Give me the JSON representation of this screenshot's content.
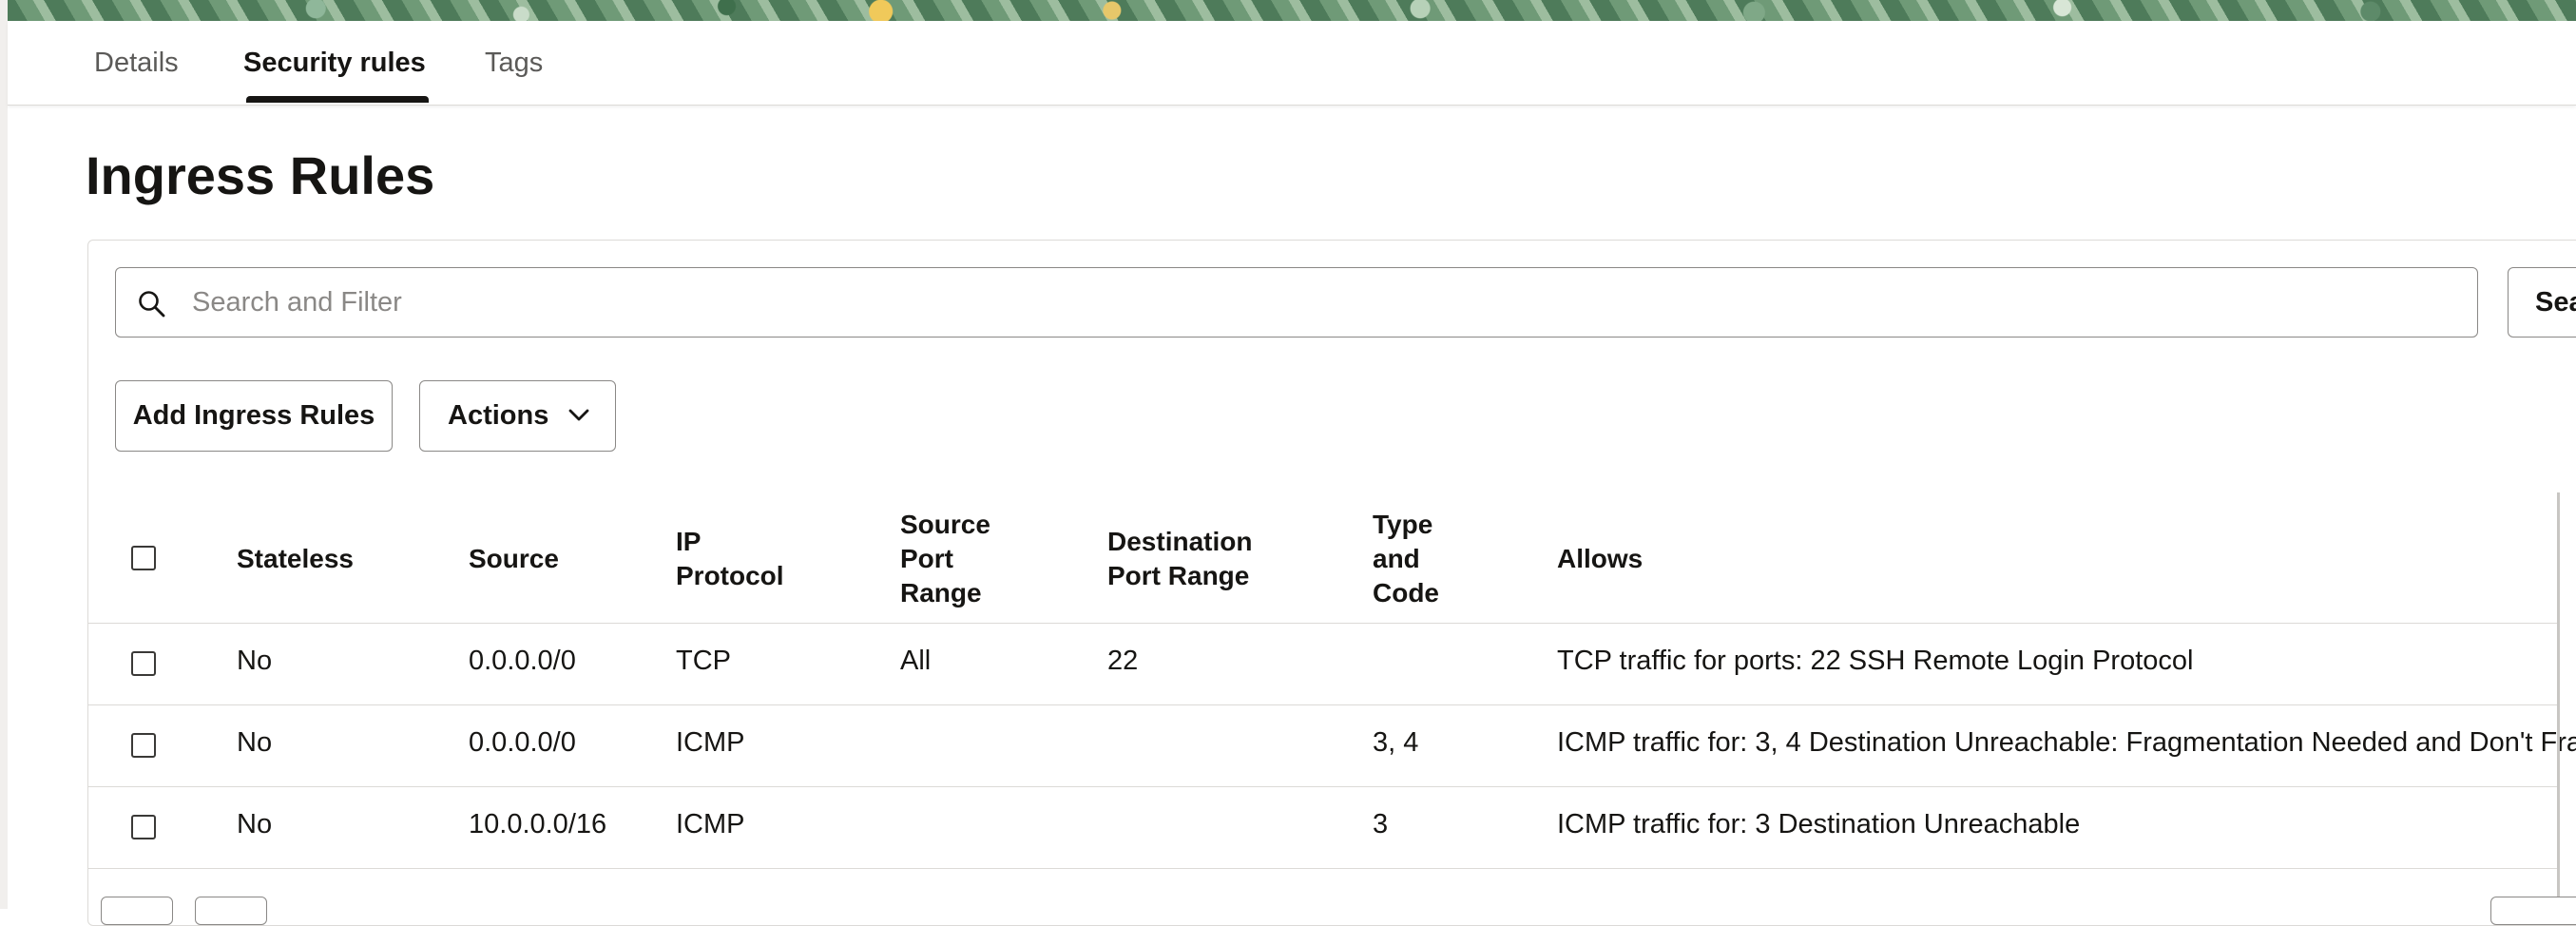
{
  "tabs": [
    {
      "label": "Details",
      "active": false
    },
    {
      "label": "Security rules",
      "active": true
    },
    {
      "label": "Tags",
      "active": false
    }
  ],
  "page_title": "Ingress Rules",
  "search": {
    "placeholder": "Search and Filter",
    "value": "",
    "button_label": "Sea"
  },
  "toolbar": {
    "add_label": "Add Ingress Rules",
    "actions_label": "Actions"
  },
  "table": {
    "headers": {
      "stateless": "Stateless",
      "source": "Source",
      "ip_protocol": [
        "IP",
        "Protocol"
      ],
      "source_port_range": [
        "Source",
        "Port",
        "Range"
      ],
      "destination_port_range": [
        "Destination",
        "Port Range"
      ],
      "type_and_code": [
        "Type",
        "and",
        "Code"
      ],
      "allows": "Allows"
    },
    "rows": [
      {
        "stateless": "No",
        "source": "0.0.0.0/0",
        "ip_protocol": "TCP",
        "source_port_range": "All",
        "destination_port_range": "22",
        "type_and_code": "",
        "allows": "TCP traffic for ports: 22 SSH Remote Login Protocol"
      },
      {
        "stateless": "No",
        "source": "0.0.0.0/0",
        "ip_protocol": "ICMP",
        "source_port_range": "",
        "destination_port_range": "",
        "type_and_code": "3, 4",
        "allows": "ICMP traffic for: 3, 4 Destination Unreachable: Fragmentation Needed and Don't Fra"
      },
      {
        "stateless": "No",
        "source": "10.0.0.0/16",
        "ip_protocol": "ICMP",
        "source_port_range": "",
        "destination_port_range": "",
        "type_and_code": "3",
        "allows": "ICMP traffic for: 3 Destination Unreachable"
      }
    ]
  },
  "colors": {
    "text": "#161513",
    "muted": "#5b5a58",
    "border": "#8a8886",
    "divider": "#dcdad7"
  },
  "icons": {
    "search": "search-icon",
    "actions_chevron": "chevron-down-icon",
    "checkbox": "checkbox-icon"
  }
}
